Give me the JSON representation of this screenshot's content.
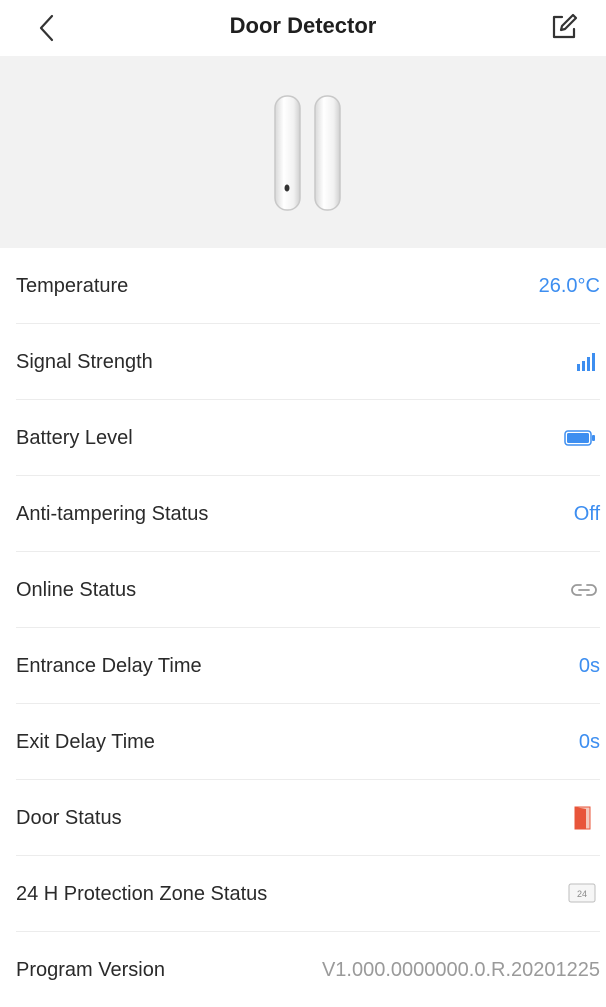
{
  "header": {
    "title": "Door Detector"
  },
  "rows": [
    {
      "label": "Temperature",
      "value": "26.0°C"
    },
    {
      "label": "Signal Strength",
      "icon": "signal-bars-icon"
    },
    {
      "label": "Battery Level",
      "icon": "battery-icon"
    },
    {
      "label": "Anti-tampering Status",
      "value": "Off"
    },
    {
      "label": "Online Status",
      "icon": "link-icon"
    },
    {
      "label": "Entrance Delay Time",
      "value": "0s"
    },
    {
      "label": "Exit Delay Time",
      "value": "0s"
    },
    {
      "label": "Door Status",
      "icon": "door-open-icon"
    },
    {
      "label": "24 H Protection Zone Status",
      "icon": "24h-zone-icon",
      "icon_text": "24"
    },
    {
      "label": "Program Version",
      "value": "V1.000.0000000.0.R.20201225"
    }
  ],
  "colors": {
    "accent": "#3d8ef0",
    "door": "#e8553a",
    "muted": "#9a9a9a"
  }
}
